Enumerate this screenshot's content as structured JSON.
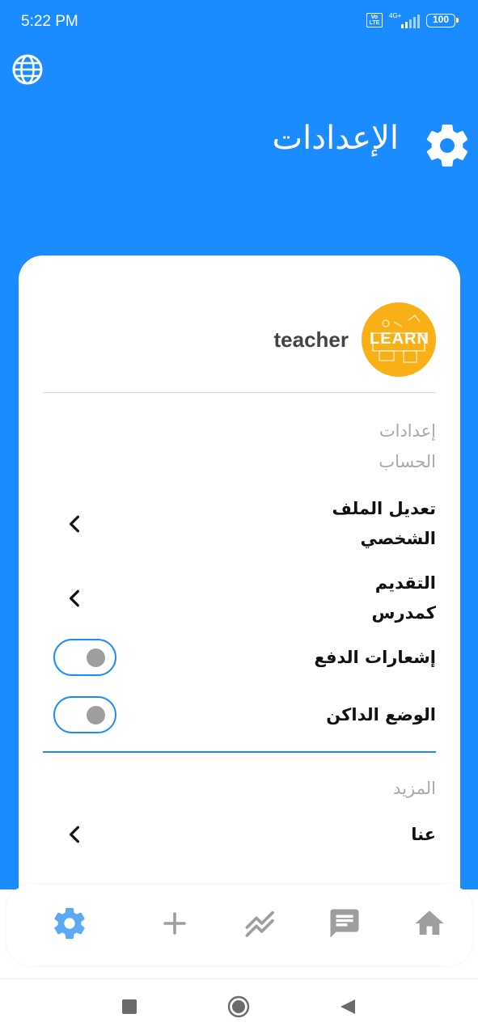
{
  "status_bar": {
    "time": "5:22 PM",
    "volte": "Vo LTE",
    "network": "4G+",
    "battery": "100"
  },
  "header": {
    "title": "الإعدادات",
    "icon": "gear-icon",
    "language_icon": "globe-icon"
  },
  "profile": {
    "username": "teacher",
    "avatar_text": "LEARN"
  },
  "account_section": {
    "label_line1": "إعدادات",
    "label_line2": "الحساب",
    "items": [
      {
        "line1": "تعديل الملف",
        "line2": "الشخصي",
        "type": "link"
      },
      {
        "line1": "التقديم",
        "line2": "كمدرس",
        "type": "link"
      },
      {
        "label": "إشعارات الدفع",
        "type": "toggle",
        "on": false
      },
      {
        "label": "الوضع الداكن",
        "type": "toggle",
        "on": false
      }
    ]
  },
  "more_section": {
    "label": "المزيد",
    "items": [
      {
        "label": "عنا",
        "type": "link"
      }
    ]
  },
  "bottom_nav": {
    "items": [
      {
        "icon": "gear-icon",
        "active": true
      },
      {
        "icon": "plus-icon",
        "active": false
      },
      {
        "icon": "trending-icon",
        "active": false
      },
      {
        "icon": "chat-icon",
        "active": false
      },
      {
        "icon": "home-icon",
        "active": false
      }
    ]
  },
  "colors": {
    "primary": "#1A8CFF",
    "muted_label": "#A9A9A9",
    "nav_inactive": "#9E9E9E",
    "nav_active": "#5AA9F5",
    "avatar_bg": "#F9B016"
  }
}
